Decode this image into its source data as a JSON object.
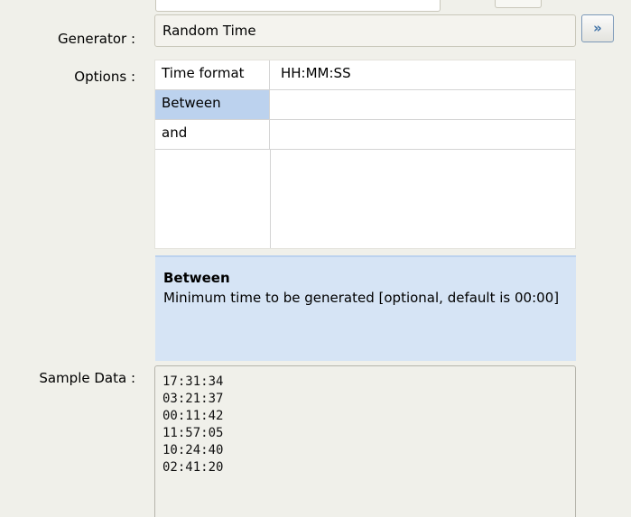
{
  "labels": {
    "generator": "Generator :",
    "options": "Options :",
    "sample_data": "Sample Data :"
  },
  "generator": {
    "value": "Random Time",
    "expand_icon": "double-chevron-down-icon"
  },
  "options": {
    "rows": [
      {
        "key": "Time format",
        "value": "HH:MM:SS",
        "selected": false
      },
      {
        "key": "Between",
        "value": "",
        "selected": true
      },
      {
        "key": "and",
        "value": "",
        "selected": false
      }
    ]
  },
  "help": {
    "title": "Between",
    "description": "Minimum time to be generated [optional, default is 00:00]"
  },
  "sample_data": [
    "17:31:34",
    "03:21:37",
    "00:11:42",
    "11:57:05",
    "10:24:40",
    "02:41:20"
  ],
  "colors": {
    "background": "#f0f0ea",
    "selected_row": "#bcd2ee",
    "help_background": "#d6e4f5"
  }
}
